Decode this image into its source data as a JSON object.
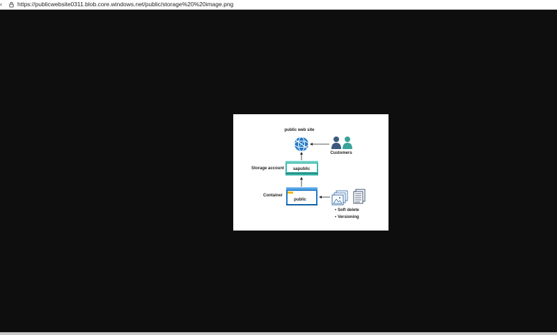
{
  "browser": {
    "url": "https://publicwebsite0311.blob.core.windows.net/public/storage%20%20image.png"
  },
  "diagram": {
    "top_label": "public web site",
    "customers_label": "Customers",
    "storage_account_label": "Storage account",
    "storage_account_name": "sapublic",
    "container_label": "Container",
    "container_name": "public",
    "features": [
      "Soft delete",
      "Versioning"
    ],
    "colors": {
      "teal": "#3fb8ad",
      "blue": "#1f78c8",
      "person_dark": "#3a5a80",
      "person_teal": "#3aa39a"
    }
  }
}
